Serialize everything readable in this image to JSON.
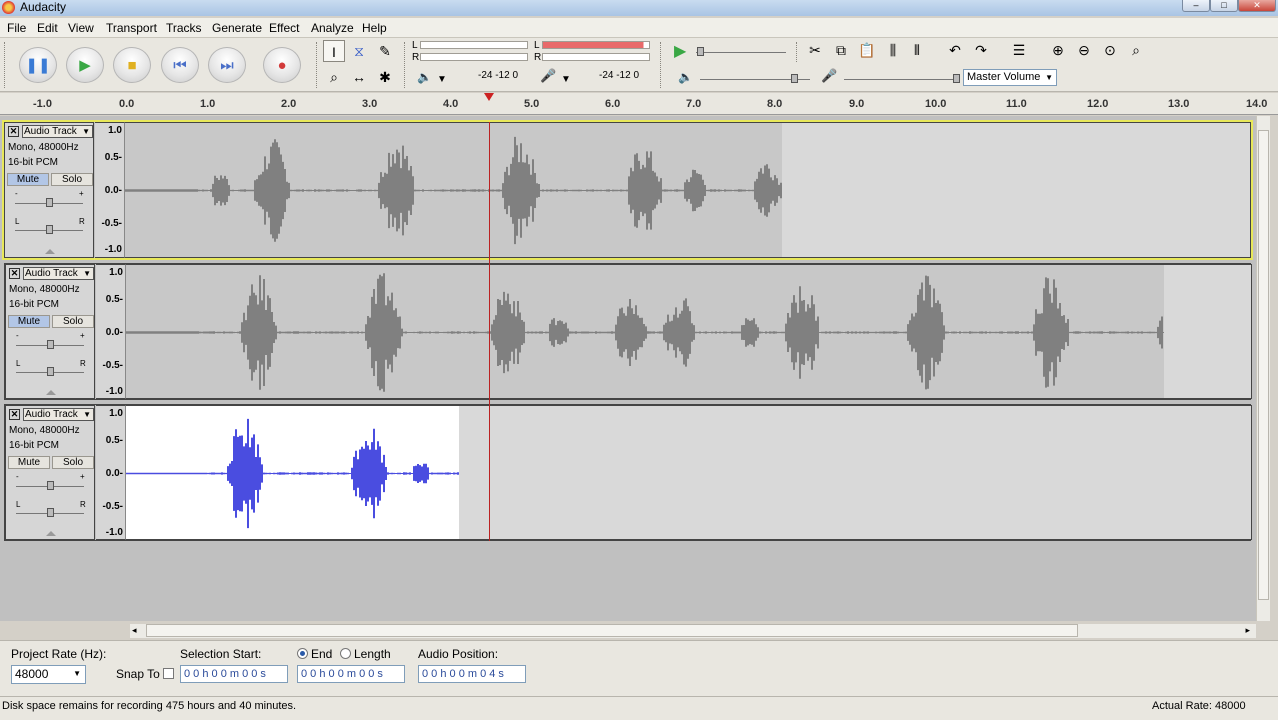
{
  "window": {
    "title": "Audacity",
    "minimize": "–",
    "maximize": "□",
    "close": "✕"
  },
  "menu": [
    "File",
    "Edit",
    "View",
    "Transport",
    "Tracks",
    "Generate",
    "Effect",
    "Analyze",
    "Help"
  ],
  "transport": {
    "pause_icon": "pause-icon",
    "play_icon": "play-icon",
    "stop_icon": "stop-icon",
    "skip_start_icon": "skip-to-start-icon",
    "skip_end_icon": "skip-to-end-icon",
    "record_icon": "record-icon"
  },
  "meters": {
    "play_L": "L",
    "play_R": "R",
    "rec_L": "L",
    "rec_R": "R",
    "scale_a": "-24 -12  0",
    "scale_b": "-24 -12  0",
    "rec_level": 0.95
  },
  "mixer": {
    "output_volume": 0.65,
    "input_volume": 0.95,
    "input_source": "Master Volume"
  },
  "ruler": {
    "ticks": [
      "-1.0",
      "0.0",
      "1.0",
      "2.0",
      "3.0",
      "4.0",
      "5.0",
      "6.0",
      "7.0",
      "8.0",
      "9.0",
      "10.0",
      "11.0",
      "12.0",
      "13.0",
      "14.0"
    ]
  },
  "tracks": [
    {
      "name": "Audio Track",
      "format": "Mono, 48000Hz",
      "bits": "16-bit PCM",
      "mute": "Mute",
      "solo": "Solo",
      "mute_on": true,
      "selected": true,
      "color": "#808080",
      "length_sec": 8.1
    },
    {
      "name": "Audio Track",
      "format": "Mono, 48000Hz",
      "bits": "16-bit PCM",
      "mute": "Mute",
      "solo": "Solo",
      "mute_on": true,
      "selected": false,
      "color": "#808080",
      "length_sec": 12.8
    },
    {
      "name": "Audio Track",
      "format": "Mono, 48000Hz",
      "bits": "16-bit PCM",
      "mute": "Mute",
      "solo": "Solo",
      "mute_on": false,
      "selected": false,
      "color": "#4a4de0",
      "length_sec": 4.1
    }
  ],
  "vscale": [
    "1.0",
    "0.5-",
    "0.0-",
    "-0.5-",
    "-1.0"
  ],
  "slider_labels": {
    "minus": "-",
    "plus": "+",
    "L": "L",
    "R": "R"
  },
  "bottom": {
    "project_rate_label": "Project Rate (Hz):",
    "project_rate": "48000",
    "snap_to": "Snap To",
    "selection_start_label": "Selection Start:",
    "end_label": "End",
    "length_label": "Length",
    "audio_position_label": "Audio Position:",
    "sel_start": "0 0 h 0 0 m 0 0 s",
    "sel_end": "0 0 h 0 0 m 0 0 s",
    "audio_pos": "0 0 h 0 0 m 0 4 s"
  },
  "status": {
    "left": "Disk space remains for recording 475 hours and 40 minutes.",
    "right": "Actual Rate: 48000"
  }
}
